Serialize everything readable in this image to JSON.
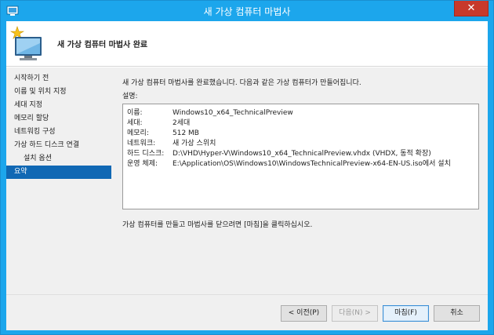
{
  "window": {
    "title": "새 가상 컴퓨터 마법사",
    "close_glyph": "✕"
  },
  "header": {
    "title": "새 가상 컴퓨터 마법사 완료"
  },
  "nav": {
    "items": [
      {
        "label": "시작하기 전",
        "active": false
      },
      {
        "label": "이름 및 위치 지정",
        "active": false
      },
      {
        "label": "세대 지정",
        "active": false
      },
      {
        "label": "메모리 할당",
        "active": false
      },
      {
        "label": "네트워킹 구성",
        "active": false
      },
      {
        "label": "가상 하드 디스크 연결",
        "active": false
      },
      {
        "label": "설치 옵션",
        "active": false
      },
      {
        "label": "요약",
        "active": true
      }
    ]
  },
  "content": {
    "intro": "새 가상 컴퓨터 마법사를 완료했습니다. 다음과 같은 가상 컴퓨터가 만들어집니다.",
    "desc_label": "설명:",
    "summary": [
      {
        "key": "이름:",
        "value": "Windows10_x64_TechnicalPreview"
      },
      {
        "key": "세대:",
        "value": "2세대"
      },
      {
        "key": "메모리:",
        "value": "512 MB"
      },
      {
        "key": "네트워크:",
        "value": "새 가상 스위치"
      },
      {
        "key": "하드 디스크:",
        "value": "D:\\VHD\\Hyper-V\\Windows10_x64_TechnicalPreview.vhdx (VHDX, 동적 확장)"
      },
      {
        "key": "운영 체제:",
        "value": "E:\\Application\\OS\\Windows10\\WindowsTechnicalPreview-x64-EN-US.iso에서 설치"
      }
    ],
    "footer_note": "가상 컴퓨터를 만들고 마법사를 닫으려면 [마침]을 클릭하십시오."
  },
  "buttons": {
    "prev": "< 이전(P)",
    "next": "다음(N) >",
    "finish": "마침(F)",
    "cancel": "취소"
  },
  "colors": {
    "titlebar": "#1ca6ec",
    "close": "#c7392b",
    "nav_active": "#1068b4"
  }
}
